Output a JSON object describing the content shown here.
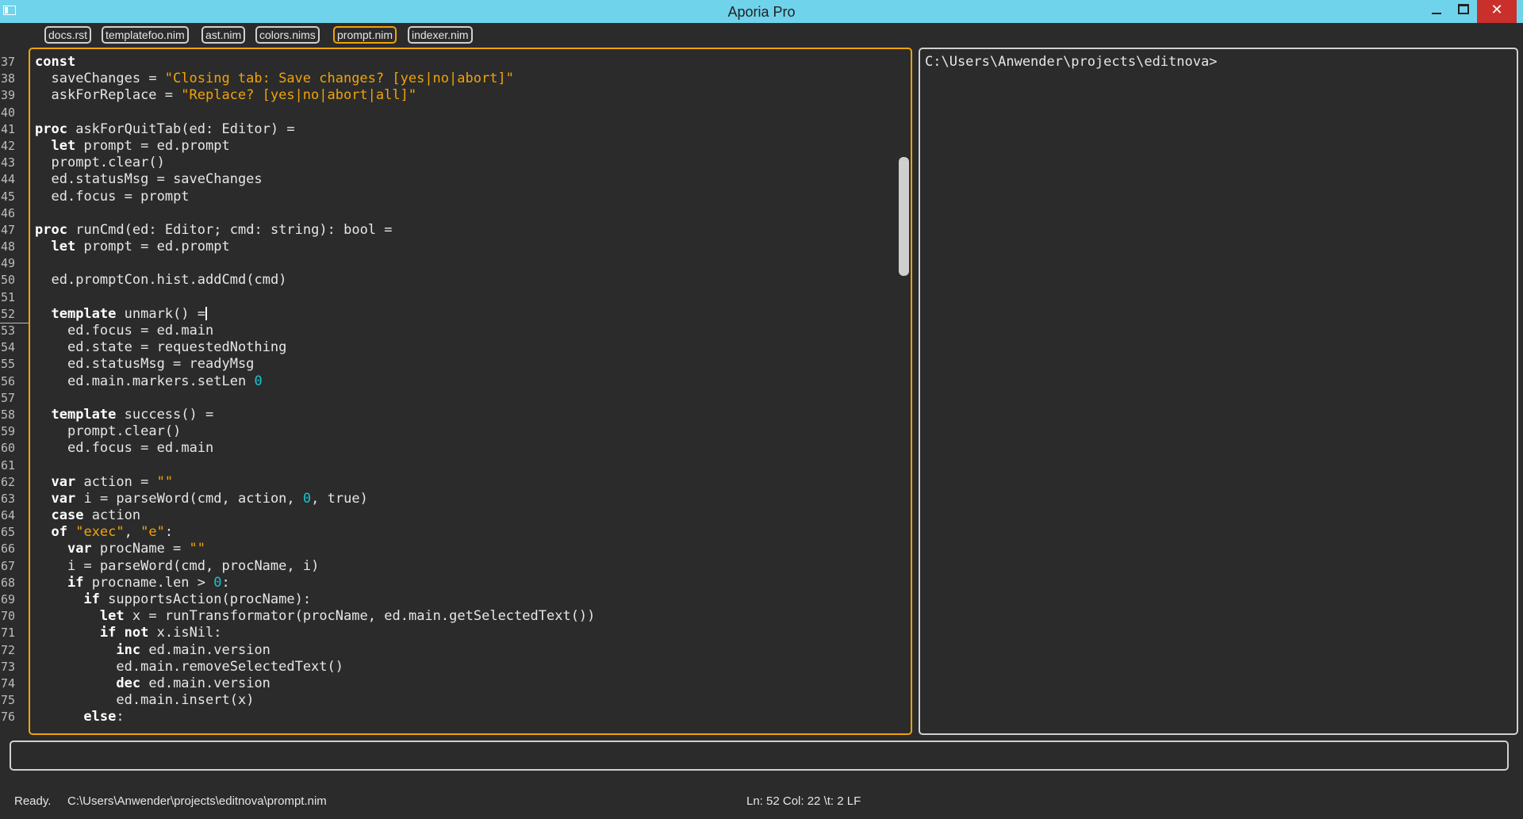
{
  "window": {
    "title": "Aporia Pro",
    "minimize_label": "",
    "maximize_label": "",
    "close_label": "✕",
    "colors": {
      "titlebar": "#6fd3ec",
      "close": "#c9302c",
      "accent": "#f0a30a"
    }
  },
  "tabs": [
    {
      "label": "docs.rst",
      "active": false
    },
    {
      "label": "templatefoo.nim",
      "active": false
    },
    {
      "label": "ast.nim",
      "active": false
    },
    {
      "label": "colors.nims",
      "active": false
    },
    {
      "label": "prompt.nim",
      "active": true
    },
    {
      "label": "indexer.nim",
      "active": false
    }
  ],
  "editor": {
    "current_line": 52,
    "lines": [
      {
        "n": "37",
        "code": "const"
      },
      {
        "n": "38",
        "code": "  saveChanges = \"Closing tab: Save changes? [yes|no|abort]\""
      },
      {
        "n": "39",
        "code": "  askForReplace = \"Replace? [yes|no|abort|all]\""
      },
      {
        "n": "40",
        "code": ""
      },
      {
        "n": "41",
        "code": "proc askForQuitTab(ed: Editor) ="
      },
      {
        "n": "42",
        "code": "  let prompt = ed.prompt"
      },
      {
        "n": "43",
        "code": "  prompt.clear()"
      },
      {
        "n": "44",
        "code": "  ed.statusMsg = saveChanges"
      },
      {
        "n": "45",
        "code": "  ed.focus = prompt"
      },
      {
        "n": "46",
        "code": ""
      },
      {
        "n": "47",
        "code": "proc runCmd(ed: Editor; cmd: string): bool ="
      },
      {
        "n": "48",
        "code": "  let prompt = ed.prompt"
      },
      {
        "n": "49",
        "code": ""
      },
      {
        "n": "50",
        "code": "  ed.promptCon.hist.addCmd(cmd)"
      },
      {
        "n": "51",
        "code": ""
      },
      {
        "n": "52",
        "code": "  template unmark() ="
      },
      {
        "n": "53",
        "code": "    ed.focus = ed.main"
      },
      {
        "n": "54",
        "code": "    ed.state = requestedNothing"
      },
      {
        "n": "55",
        "code": "    ed.statusMsg = readyMsg"
      },
      {
        "n": "56",
        "code": "    ed.main.markers.setLen 0"
      },
      {
        "n": "57",
        "code": ""
      },
      {
        "n": "58",
        "code": "  template success() ="
      },
      {
        "n": "59",
        "code": "    prompt.clear()"
      },
      {
        "n": "60",
        "code": "    ed.focus = ed.main"
      },
      {
        "n": "61",
        "code": ""
      },
      {
        "n": "62",
        "code": "  var action = \"\""
      },
      {
        "n": "63",
        "code": "  var i = parseWord(cmd, action, 0, true)"
      },
      {
        "n": "64",
        "code": "  case action"
      },
      {
        "n": "65",
        "code": "  of \"exec\", \"e\":"
      },
      {
        "n": "66",
        "code": "    var procName = \"\""
      },
      {
        "n": "67",
        "code": "    i = parseWord(cmd, procName, i)"
      },
      {
        "n": "68",
        "code": "    if procname.len > 0:"
      },
      {
        "n": "69",
        "code": "      if supportsAction(procName):"
      },
      {
        "n": "70",
        "code": "        let x = runTransformator(procName, ed.main.getSelectedText())"
      },
      {
        "n": "71",
        "code": "        if not x.isNil:"
      },
      {
        "n": "72",
        "code": "          inc ed.main.version"
      },
      {
        "n": "73",
        "code": "          ed.main.removeSelectedText()"
      },
      {
        "n": "74",
        "code": "          dec ed.main.version"
      },
      {
        "n": "75",
        "code": "          ed.main.insert(x)"
      },
      {
        "n": "76",
        "code": "      else:"
      }
    ]
  },
  "console": {
    "text": "C:\\Users\\Anwender\\projects\\editnova>"
  },
  "prompt": {
    "value": ""
  },
  "statusbar": {
    "state": "Ready.",
    "path": "C:\\Users\\Anwender\\projects\\editnova\\prompt.nim",
    "position": "Ln: 52 Col: 22 \\t: 2 LF"
  }
}
